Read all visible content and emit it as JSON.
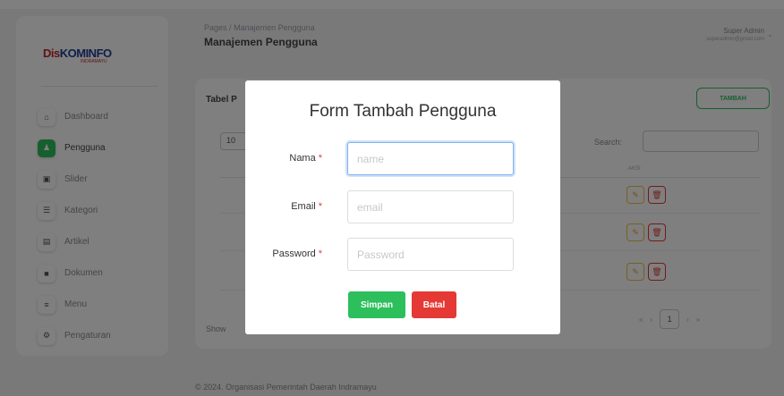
{
  "header": {
    "breadcrumb_root": "Pages",
    "breadcrumb_sep": "/",
    "breadcrumb_current": "Manajemen Pengguna",
    "page_title": "Manajemen Pengguna",
    "user_name": "Super Admin",
    "user_email": "superadmin@gmail.com"
  },
  "logo": {
    "part1": "Dis",
    "part2": "KOMINFO",
    "sub": "INDRAMAYU"
  },
  "sidebar": {
    "items": [
      {
        "label": "Dashboard",
        "icon": "home-icon"
      },
      {
        "label": "Pengguna",
        "icon": "users-icon"
      },
      {
        "label": "Slider",
        "icon": "image-icon"
      },
      {
        "label": "Kategori",
        "icon": "list-icon"
      },
      {
        "label": "Artikel",
        "icon": "article-icon"
      },
      {
        "label": "Dokumen",
        "icon": "document-icon"
      },
      {
        "label": "Menu",
        "icon": "menu-icon"
      },
      {
        "label": "Pengaturan",
        "icon": "settings-icon"
      }
    ]
  },
  "card": {
    "title": "Tabel P",
    "add_button": "TAMBAH",
    "length_value": "10",
    "search_label": "Search:",
    "action_header": "AKSI",
    "show_text": "Show",
    "pagination": {
      "first": "«",
      "prev": "‹",
      "current": "1",
      "next": "›",
      "last": "»"
    }
  },
  "footer": {
    "text": "© 2024. Organisasi Pemerintah Daerah Indramayu"
  },
  "modal": {
    "title": "Form Tambah Pengguna",
    "required_mark": "*",
    "fields": {
      "name": {
        "label": "Nama",
        "placeholder": "name"
      },
      "email": {
        "label": "Email",
        "placeholder": "email"
      },
      "password": {
        "label": "Password",
        "placeholder": "Password"
      }
    },
    "save_label": "Simpan",
    "cancel_label": "Batal"
  },
  "colors": {
    "accent": "#2dbf5c",
    "danger": "#e53935",
    "warning": "#f0c23a"
  }
}
